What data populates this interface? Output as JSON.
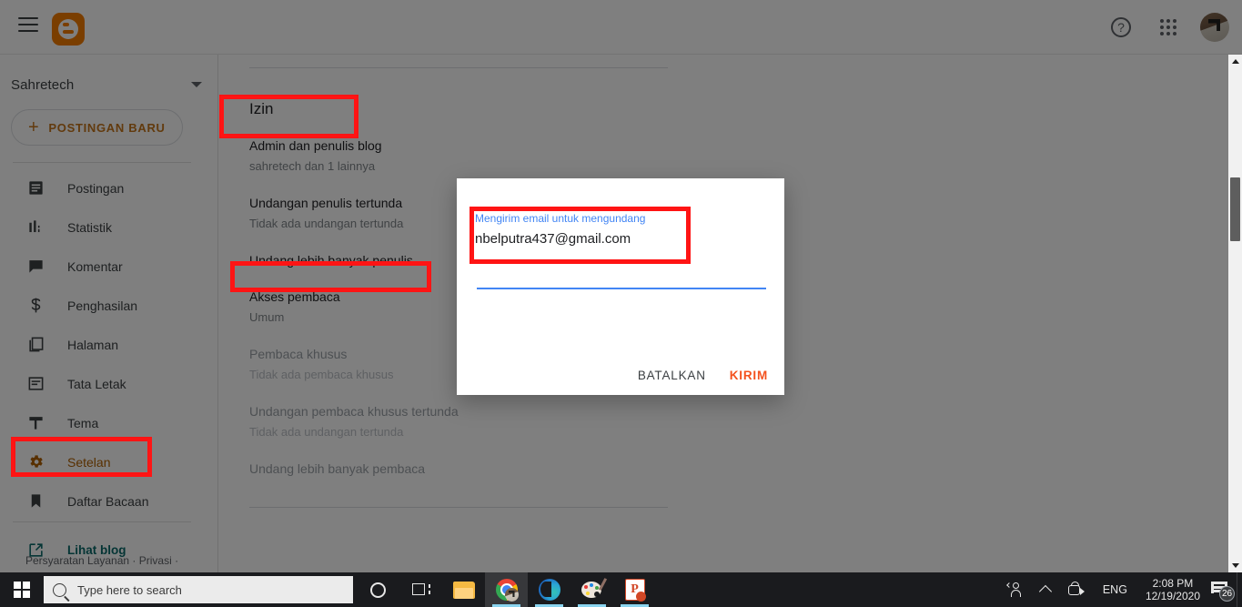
{
  "browser": {
    "topbar": {
      "menu_icon": "hamburger-icon",
      "logo_icon": "blogger-logo-icon",
      "help_label": "?",
      "help_icon": "help-circle-icon",
      "apps_icon": "apps-grid-icon",
      "avatar_icon": "user-avatar"
    }
  },
  "sidebar": {
    "blog_name": "Sahretech",
    "blog_caret_icon": "chevron-down-icon",
    "new_post_plus": "+",
    "new_post_label": "POSTINGAN BARU",
    "items": [
      {
        "label": "Postingan",
        "icon": "posts-icon",
        "active": false
      },
      {
        "label": "Statistik",
        "icon": "stats-icon",
        "active": false
      },
      {
        "label": "Komentar",
        "icon": "comment-icon",
        "active": false
      },
      {
        "label": "Penghasilan",
        "icon": "dollar-icon",
        "active": false
      },
      {
        "label": "Halaman",
        "icon": "pages-icon",
        "active": false
      },
      {
        "label": "Tata Letak",
        "icon": "layout-icon",
        "active": false
      },
      {
        "label": "Tema",
        "icon": "theme-icon",
        "active": false
      },
      {
        "label": "Setelan",
        "icon": "gear-icon",
        "active": true
      },
      {
        "label": "Daftar Bacaan",
        "icon": "bookmark-icon",
        "active": false
      }
    ],
    "view_blog": {
      "label": "Lihat blog",
      "icon": "external-link-icon"
    },
    "footer": "Persyaratan Layanan  ·  Privasi  ·"
  },
  "content": {
    "section_title": "Izin",
    "rows": [
      {
        "title": "Admin dan penulis blog",
        "sub": "sahretech dan 1 lainnya",
        "dim": false
      },
      {
        "title": "Undangan penulis tertunda",
        "sub": "Tidak ada undangan tertunda",
        "dim": false
      },
      {
        "title": "Undang lebih banyak penulis",
        "sub": "",
        "dim": false
      },
      {
        "title": "Akses pembaca",
        "sub": "Umum",
        "dim": false
      },
      {
        "title": "Pembaca khusus",
        "sub": "Tidak ada pembaca khusus",
        "dim": true
      },
      {
        "title": "Undangan pembaca khusus tertunda",
        "sub": "Tidak ada undangan tertunda",
        "dim": true
      },
      {
        "title": "Undang lebih banyak pembaca",
        "sub": "",
        "dim": true
      }
    ]
  },
  "dialog": {
    "field_label": "Mengirim email untuk mengundang",
    "field_value": "nbelputra437@gmail.com",
    "field_placeholder": "nbelputra437@gmail.com",
    "cancel_label": "BATALKAN",
    "send_label": "KIRIM",
    "accent_color": "#4285f4",
    "send_color": "#f4511e"
  },
  "annotations": {
    "color": "#ff1414",
    "boxes": [
      {
        "name": "izin-heading"
      },
      {
        "name": "undang-penulis-row"
      },
      {
        "name": "setelan-nav-item"
      },
      {
        "name": "email-field"
      }
    ]
  },
  "scrollbar": {
    "up_icon": "scroll-up-arrow",
    "down_icon": "scroll-down-arrow"
  },
  "taskbar": {
    "start_icon": "windows-start-icon",
    "search_placeholder": "Type here to search",
    "search_icon": "search-icon",
    "items": [
      {
        "name": "cortana-icon"
      },
      {
        "name": "task-view-icon"
      },
      {
        "name": "file-explorer-icon"
      },
      {
        "name": "chrome-icon"
      },
      {
        "name": "edge-icon"
      },
      {
        "name": "paint-icon"
      },
      {
        "name": "powerpoint-icon"
      }
    ],
    "tray": {
      "people_icon": "people-icon",
      "chevron_icon": "chevron-up-icon",
      "meet_icon": "camera-icon",
      "language": "ENG",
      "time": "2:08 PM",
      "date": "12/19/2020",
      "notification_icon": "notification-icon",
      "notification_count": "26"
    }
  }
}
